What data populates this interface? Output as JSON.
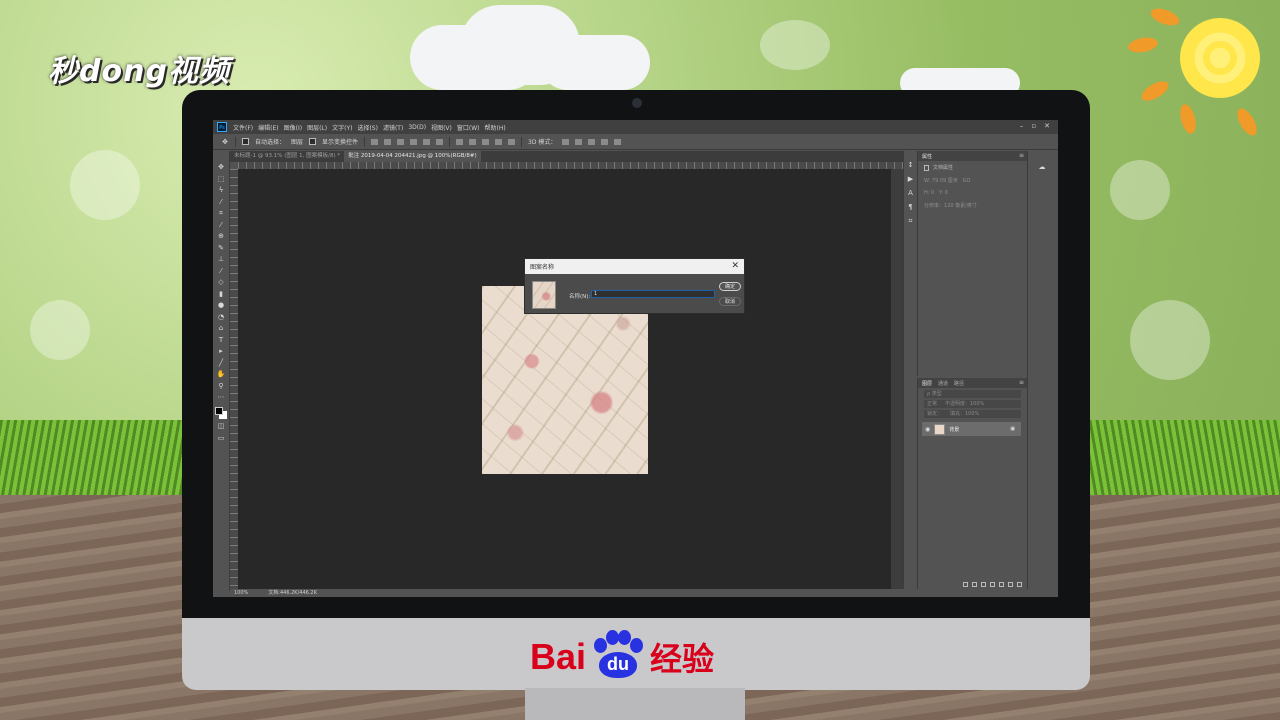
{
  "overlay": {
    "brand_logo": "秒dong视频",
    "baidu_logo": {
      "left": "Bai",
      "paw": "du",
      "right": "经验"
    }
  },
  "app": {
    "menu": [
      "文件(F)",
      "编辑(E)",
      "图像(I)",
      "图层(L)",
      "文字(Y)",
      "选择(S)",
      "滤镜(T)",
      "3D(D)",
      "视图(V)",
      "窗口(W)",
      "帮助(H)"
    ],
    "window_controls": [
      "–",
      "▫",
      "✕"
    ],
    "options_bar": {
      "auto_select_label": "自动选择：",
      "auto_select_value": "图层",
      "transform_controls_label": "显示变换控件",
      "mode_3d_label": "3D 模式："
    },
    "tabs": [
      {
        "label": "未标题-1 @ 93.1% (图层 1, 图案模板/8) *"
      },
      {
        "label": "批注 2019-04-04 204421.jpg @ 100%(RGB/8#)"
      }
    ],
    "status": {
      "zoom": "100%",
      "doc_size": "文档:446.2K/446.2K"
    }
  },
  "dialog": {
    "title": "图案名称",
    "close": "✕",
    "name_label": "名称(N):",
    "name_value": "1",
    "ok_label": "确定",
    "cancel_label": "取消"
  },
  "properties_panel": {
    "tab": "属性",
    "section": "文档属性",
    "fields": [
      {
        "label": "W: 79.09 厘米",
        "extra": "GO"
      },
      {
        "label": "H: 0",
        "extra": "Y: 0"
      },
      {
        "label": "分辨率：120 像素/英寸",
        "extra": ""
      }
    ]
  },
  "layers_panel": {
    "tabs": [
      "图层",
      "通道",
      "路径"
    ],
    "kind_filter": "ρ 类型",
    "blend_mode": "正常",
    "opacity_label": "不透明度：100%",
    "lock_label": "锁定：",
    "fill_label": "填充：100%",
    "layers": [
      {
        "name": "背景"
      }
    ]
  },
  "colors": {
    "ps_ui_bg": "#535353",
    "ps_canvas_bg": "#282828",
    "dialog_focus_border": "#1f5fa8",
    "baidu_red": "#d9001b",
    "baidu_blue": "#2932e1"
  },
  "icons": {
    "toolbox": [
      "move-icon",
      "marquee-icon",
      "lasso-icon",
      "magic-wand-icon",
      "crop-icon",
      "eyedropper-icon",
      "healing-icon",
      "brush-icon",
      "stamp-icon",
      "history-brush-icon",
      "eraser-icon",
      "gradient-icon",
      "blur-icon",
      "dodge-icon",
      "pen-icon",
      "type-icon",
      "path-select-icon",
      "shape-icon",
      "hand-icon",
      "zoom-icon",
      "more-icon"
    ]
  }
}
